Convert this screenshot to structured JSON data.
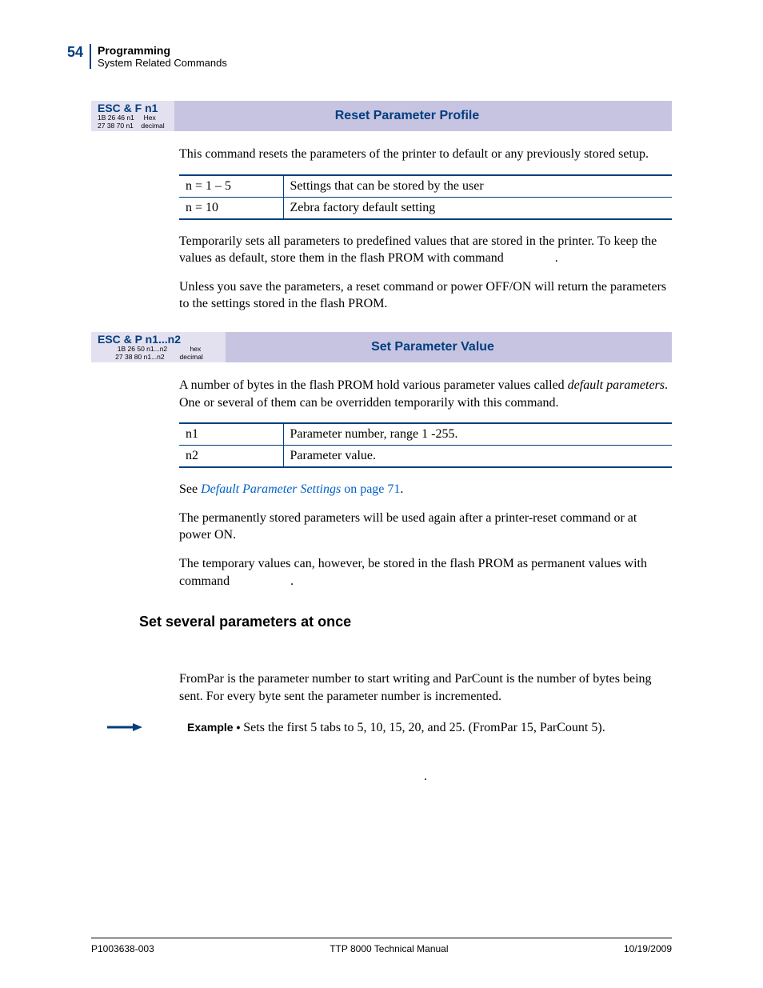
{
  "page_number": "54",
  "header": {
    "title": "Programming",
    "subtitle": "System Related Commands"
  },
  "cmd1": {
    "name": "ESC & F n1",
    "hex": "1B 26 46 n1",
    "hex_label": "Hex",
    "dec": "27 38 70 n1",
    "dec_label": "decimal",
    "title": "Reset Parameter Profile",
    "intro": "This command resets the parameters of the printer to default or any previously stored setup.",
    "table": [
      {
        "k": "n = 1 – 5",
        "v": "Settings that can be stored by the user"
      },
      {
        "k": "n = 10",
        "v": "Zebra factory default setting"
      }
    ],
    "p1": "Temporarily sets all parameters to predefined values that are stored in the printer. To keep the values as default, store them in the flash PROM with command",
    "p1_tail": ".",
    "p2": "Unless you save the parameters, a reset command or power OFF/ON will return the parameters to the settings stored in the flash PROM."
  },
  "cmd2": {
    "name": "ESC & P n1...n2",
    "hex": "1B 26 50 n1...n2",
    "hex_label": "hex",
    "dec": "27 38 80 n1...n2",
    "dec_label": "decimal",
    "title": "Set Parameter Value",
    "intro_a": "A number of bytes in the flash PROM hold various parameter values called ",
    "intro_em": "default parameters",
    "intro_b": ". One or several of them can be overridden temporarily with this command.",
    "table": [
      {
        "k": "n1",
        "v": "Parameter number, range 1 -255."
      },
      {
        "k": "n2",
        "v": "Parameter value."
      }
    ],
    "see": "See ",
    "see_link_em": "Default Parameter Settings",
    "see_link_rest": " on page 71",
    "see_tail": ".",
    "p1": "The permanently stored parameters will be used again after a printer-reset command or at power ON.",
    "p2": "The temporary values can, however, be stored in the flash PROM as permanent values with command",
    "p2_tail": "."
  },
  "section": {
    "heading": "Set several parameters at once",
    "p1": "FromPar is the parameter number to start writing and ParCount is the number of bytes being sent. For every byte sent the parameter number is incremented.",
    "example_label": "Example • ",
    "example_text": "Sets the first 5 tabs to 5, 10, 15, 20, and 25. (FromPar 15, ParCount 5).",
    "dot": "."
  },
  "footer": {
    "left": "P1003638-003",
    "center": "TTP 8000 Technical Manual",
    "right": "10/19/2009"
  }
}
